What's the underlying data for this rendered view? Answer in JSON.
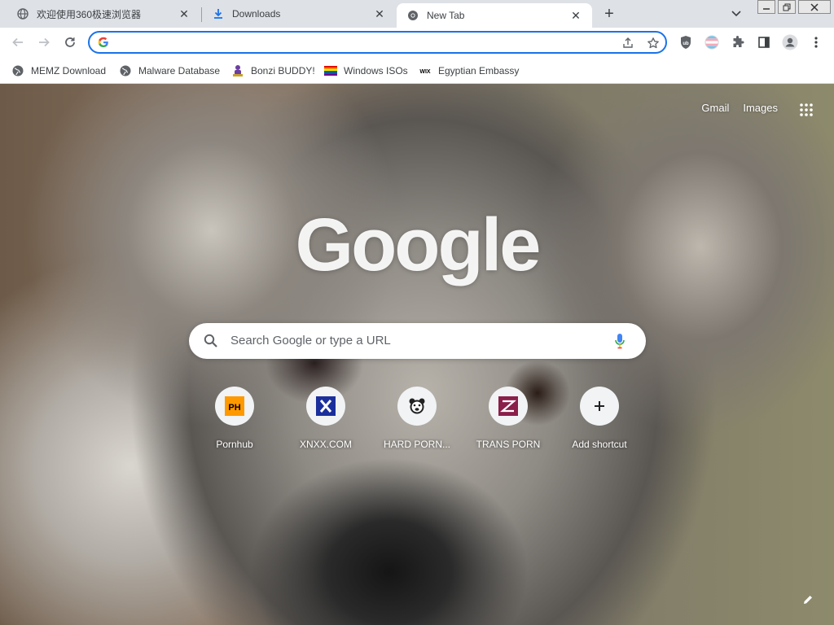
{
  "tabs": [
    {
      "title": "欢迎使用360极速浏览器",
      "icon": "globe-icon",
      "active": false
    },
    {
      "title": "Downloads",
      "icon": "download-icon",
      "active": false
    },
    {
      "title": "New Tab",
      "icon": "chrome-icon",
      "active": true
    }
  ],
  "omnibox": {
    "value": "",
    "placeholder": ""
  },
  "bookmarks": [
    {
      "label": "MEMZ Download",
      "icon": "globe-icon"
    },
    {
      "label": "Malware Database",
      "icon": "globe-icon"
    },
    {
      "label": "Bonzi BUDDY!",
      "icon": "bonzi-icon"
    },
    {
      "label": "Windows ISOs",
      "icon": "rainbow-flag-icon"
    },
    {
      "label": "Egyptian Embassy",
      "icon": "wix-icon"
    }
  ],
  "ntp": {
    "gmail": "Gmail",
    "images": "Images",
    "logo": "Google",
    "search_placeholder": "Search Google or type a URL",
    "shortcuts": [
      {
        "label": "Pornhub",
        "icon": "ph-icon"
      },
      {
        "label": "XNXX.COM",
        "icon": "x-icon"
      },
      {
        "label": "HARD PORN...",
        "icon": "bear-face-icon"
      },
      {
        "label": "TRANS PORN",
        "icon": "trans-logo-icon"
      },
      {
        "label": "Add shortcut",
        "icon": "plus-icon"
      }
    ]
  },
  "colors": {
    "accent": "#1a73e8",
    "tabstrip": "#dee1e6"
  }
}
